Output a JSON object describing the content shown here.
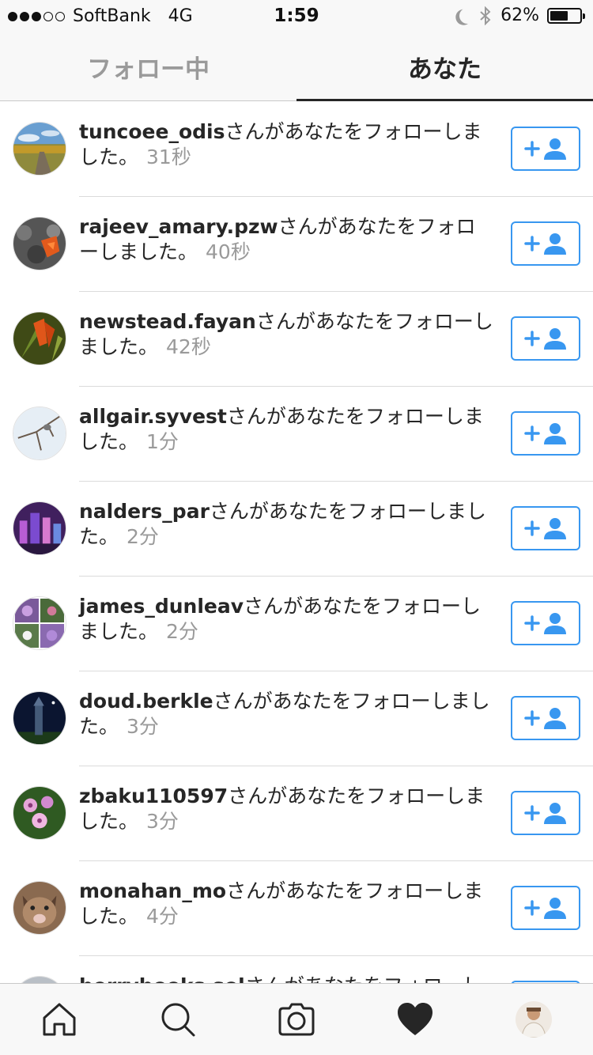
{
  "status_bar": {
    "carrier": "SoftBank",
    "network": "4G",
    "time": "1:59",
    "battery_percent": "62%",
    "battery_level": 0.62,
    "signal_bars_filled": 3,
    "signal_bars_total": 5
  },
  "tabs": [
    {
      "label": "フォロー中",
      "active": false
    },
    {
      "label": "あなた",
      "active": true
    }
  ],
  "notifications": [
    {
      "username": "tuncoee_odis",
      "message": "さんがあなたをフォローしました。",
      "time": "31秒",
      "avatar": "landscape-road"
    },
    {
      "username": "rajeev_amary.pzw",
      "message": "さんがあなたをフォローしました。",
      "time": "40秒",
      "avatar": "lava-rocks"
    },
    {
      "username": "newstead.fayan",
      "message": "さんがあなたをフォローしました。",
      "time": "42秒",
      "avatar": "orange-flower"
    },
    {
      "username": "allgair.syvest",
      "message": "さんがあなたをフォローしました。",
      "time": "1分",
      "avatar": "bird-branches"
    },
    {
      "username": "nalders_par",
      "message": "さんがあなたをフォローしました。",
      "time": "2分",
      "avatar": "city-night"
    },
    {
      "username": "james_dunleav",
      "message": "さんがあなたをフォローしました。",
      "time": "2分",
      "avatar": "flower-collage"
    },
    {
      "username": "doud.berkle",
      "message": "さんがあなたをフォローしました。",
      "time": "3分",
      "avatar": "night-tower"
    },
    {
      "username": "zbaku110597",
      "message": "さんがあなたをフォローしました。",
      "time": "3分",
      "avatar": "pink-flowers"
    },
    {
      "username": "monahan_mo",
      "message": "さんがあなたをフォローしました。",
      "time": "4分",
      "avatar": "cat"
    },
    {
      "username": "berrybooks.sol",
      "message": "さんがあなたをフォローしました。",
      "time": "",
      "avatar": "gray"
    }
  ],
  "bottom_nav": [
    "home-icon",
    "search-icon",
    "camera-icon",
    "heart-icon",
    "profile-avatar"
  ],
  "colors": {
    "accent": "#3897f0",
    "text": "#262626",
    "muted": "#9a9a9a"
  }
}
